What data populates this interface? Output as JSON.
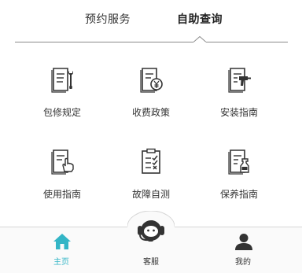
{
  "tabs": {
    "booking": "预约服务",
    "self_query": "自助查询"
  },
  "grid": [
    {
      "label": "包修规定",
      "icon": "warranty-doc-wrench-icon"
    },
    {
      "label": "收费政策",
      "icon": "fee-doc-yen-icon"
    },
    {
      "label": "安装指南",
      "icon": "install-doc-drill-icon"
    },
    {
      "label": "使用指南",
      "icon": "usage-doc-hand-icon"
    },
    {
      "label": "故障自测",
      "icon": "diagnosis-clipboard-icon"
    },
    {
      "label": "保养指南",
      "icon": "maintenance-doc-spray-icon"
    }
  ],
  "bottom_nav": {
    "home": "主页",
    "service": "客服",
    "mine": "我的"
  },
  "colors": {
    "accent": "#33b5c6",
    "icon_dark": "#333333",
    "line": "#8a8a8a"
  }
}
